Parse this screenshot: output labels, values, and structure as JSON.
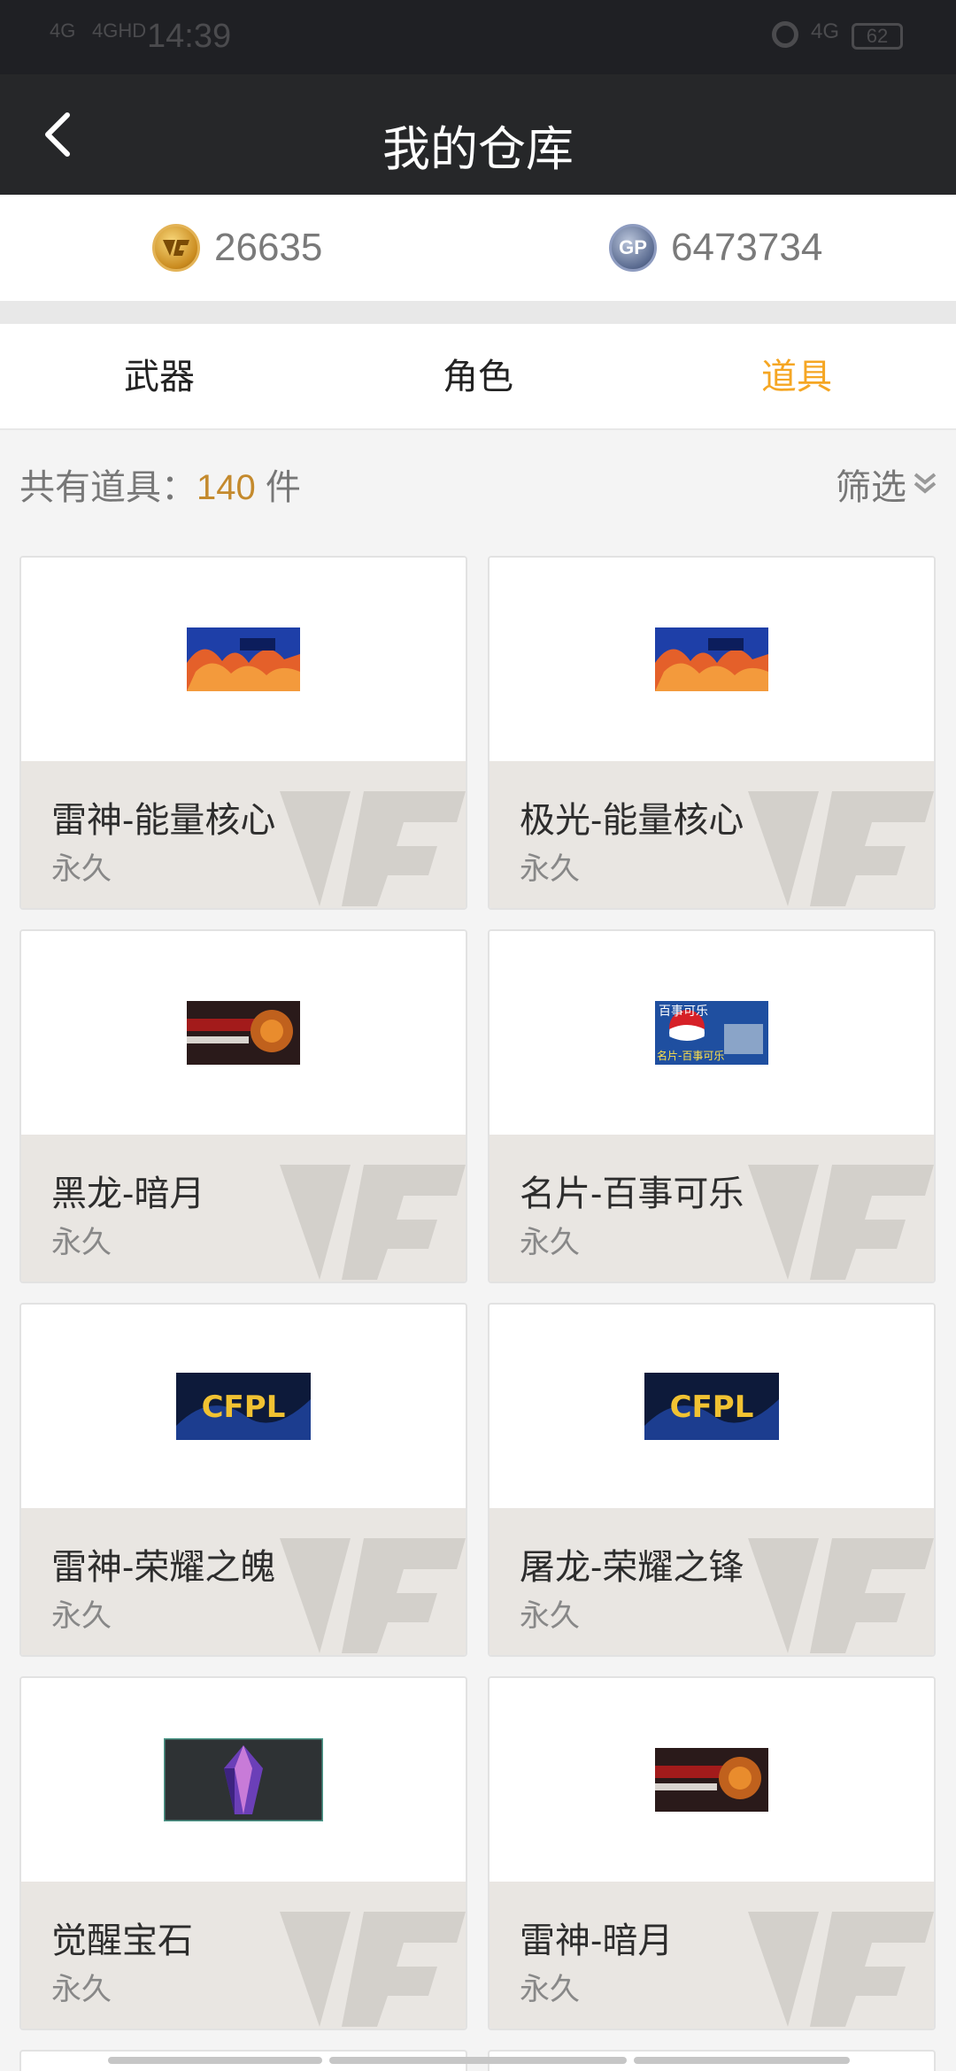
{
  "status_bar": {
    "signal1": "4G",
    "signal2": "4GHD",
    "time": "14:39",
    "net": "4G",
    "battery": "62"
  },
  "header": {
    "title": "我的仓库"
  },
  "currency": {
    "cf_points": "26635",
    "gp_icon_text": "GP",
    "gp": "6473734"
  },
  "tabs": [
    "武器",
    "角色",
    "道具"
  ],
  "active_tab": 2,
  "count": {
    "prefix": "共有道具：",
    "number": "140",
    "suffix": " 件"
  },
  "filter_label": "筛选",
  "items": [
    {
      "name": "雷神-能量核心",
      "duration": "永久",
      "thumb": "flame-blue"
    },
    {
      "name": "极光-能量核心",
      "duration": "永久",
      "thumb": "flame-blue"
    },
    {
      "name": "黑龙-暗月",
      "duration": "永久",
      "thumb": "dark-red"
    },
    {
      "name": "名片-百事可乐",
      "duration": "永久",
      "thumb": "pepsi"
    },
    {
      "name": "雷神-荣耀之魄",
      "duration": "永久",
      "thumb": "cfpl"
    },
    {
      "name": "屠龙-荣耀之锋",
      "duration": "永久",
      "thumb": "cfpl"
    },
    {
      "name": "觉醒宝石",
      "duration": "永久",
      "thumb": "gem"
    },
    {
      "name": "雷神-暗月",
      "duration": "永久",
      "thumb": "dark-red"
    }
  ],
  "thumb_texts": {
    "pepsi_top": "百事可乐",
    "pepsi_bottom": "名片-百事可乐",
    "cfpl": "CFPL"
  },
  "colors": {
    "accent": "#f5a623",
    "count_number": "#c48a2d",
    "header_bg": "#262729"
  }
}
